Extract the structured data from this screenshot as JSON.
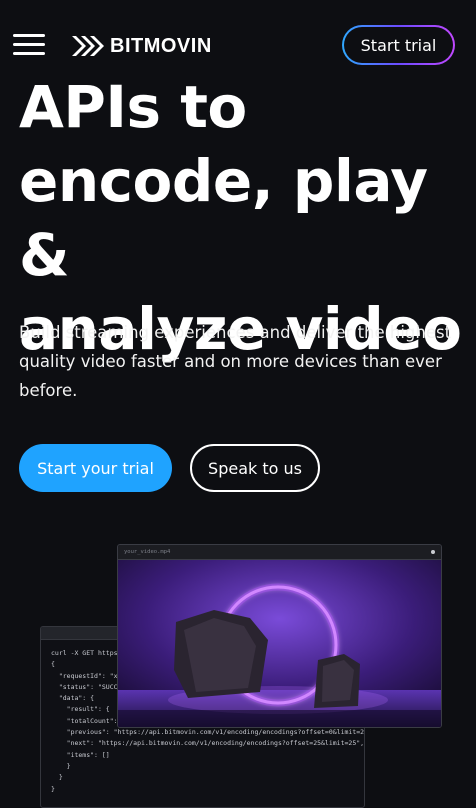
{
  "header": {
    "brand": "BITMOVIN",
    "trial_button": "Start trial",
    "menu_icon": "hamburger-menu-icon",
    "logo_icon": "bitmovin-chevrons-logo"
  },
  "hero": {
    "title_lines": [
      "APIs to",
      "encode, play &",
      "analyze video"
    ],
    "subtitle": "Build streaming experiences and deliver the highest quality video faster and on more devices than ever before.",
    "cta_primary": "Start your trial",
    "cta_secondary": "Speak to us"
  },
  "demo": {
    "video_window_title": "your_video.mp4",
    "code_snippet": "curl -X GET https://api.bitmovin.com/v1/encoding/encodings\n{\n  \"requestId\": \"x\n  \"status\": \"SUCCE\n  \"data\": {\n    \"result\": {\n    \"totalCount\":\n    \"previous\": \"https://api.bitmovin.com/v1/encoding/encodings?offset=0&limit=25\",\n    \"next\": \"https://api.bitmovin.com/v1/encoding/encodings?offset=25&limit=25\",\n    \"items\": []\n    }\n  }\n}"
  },
  "colors": {
    "background": "#0d0e12",
    "primary_cta": "#1fa3ff",
    "trial_border_gradient": [
      "#2fa8ff",
      "#6b4bff",
      "#c148ff"
    ],
    "neon_ring": "#c46bff"
  }
}
